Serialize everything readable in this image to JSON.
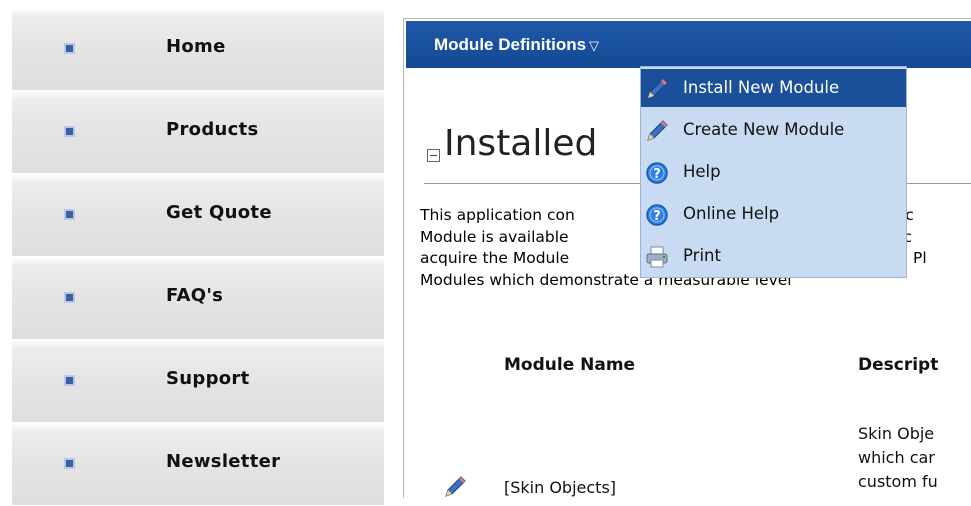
{
  "nav": {
    "items": [
      {
        "label": "Home"
      },
      {
        "label": "Products"
      },
      {
        "label": "Get Quote"
      },
      {
        "label": "FAQ's"
      },
      {
        "label": "Support"
      },
      {
        "label": "Newsletter"
      }
    ]
  },
  "module": {
    "title": "Module Definitions",
    "caret": "▽",
    "heading": "Installed",
    "paragraph": [
      "This application con",
      "Module is available",
      "acquire the Module",
      "Modules which demonstrate a measurable level"
    ],
    "paragraph_right": [
      "e whic",
      "edirec",
      "ation. Pl"
    ],
    "table": {
      "headers": [
        "Module Name",
        "Descript"
      ],
      "rows": [
        {
          "name": "[Skin Objects]",
          "description": [
            "Skin Obje",
            "which car",
            "custom fu"
          ]
        }
      ]
    }
  },
  "menu": {
    "items": [
      {
        "label": "Install New Module",
        "icon": "pencil-icon",
        "active": true
      },
      {
        "label": "Create New Module",
        "icon": "pencil-icon",
        "active": false
      },
      {
        "label": "Help",
        "icon": "help-icon",
        "active": false
      },
      {
        "label": "Online Help",
        "icon": "help-icon",
        "active": false
      },
      {
        "label": "Print",
        "icon": "printer-icon",
        "active": false
      }
    ]
  },
  "colors": {
    "titlebar": "#1a52a0",
    "menu_bg": "#c8dbf2",
    "menu_active": "#1a4f9a",
    "nav_bullet": "#3a5fa8"
  }
}
